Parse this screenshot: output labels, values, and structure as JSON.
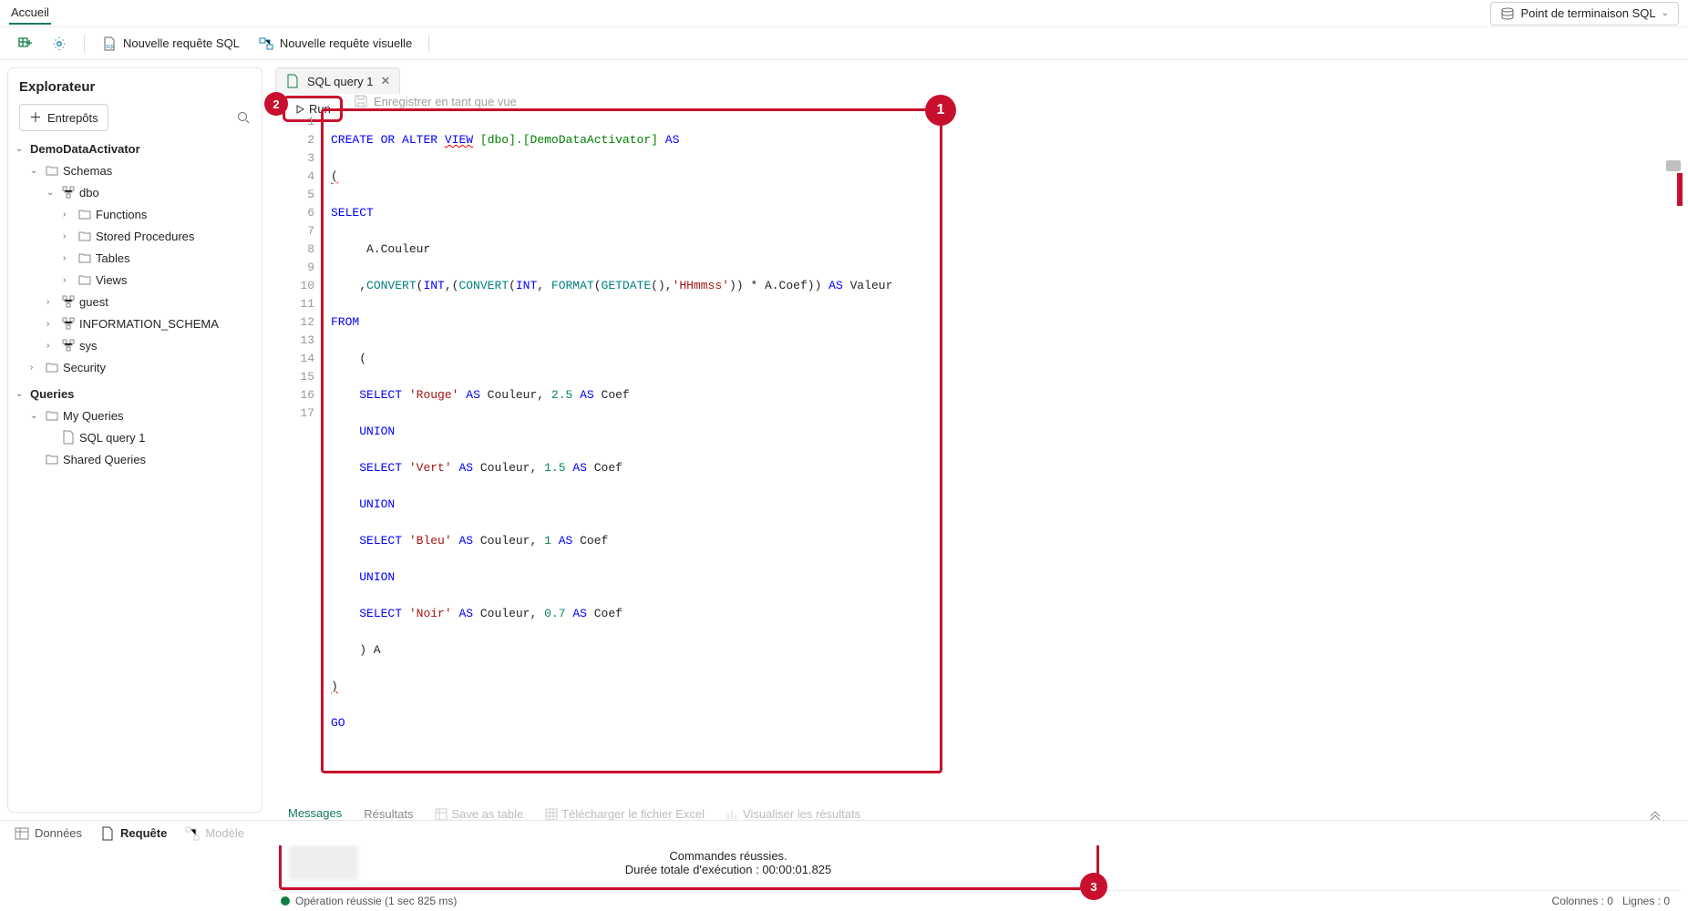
{
  "topbar": {
    "home": "Accueil",
    "endpoint": "Point de terminaison SQL"
  },
  "toolbar": {
    "new_sql": "Nouvelle requête SQL",
    "new_visual": "Nouvelle requête visuelle"
  },
  "explorer": {
    "title": "Explorateur",
    "entrepots": "Entrepôts",
    "tree": {
      "db": "DemoDataActivator",
      "schemas": "Schemas",
      "dbo": "dbo",
      "functions": "Functions",
      "sprocs": "Stored Procedures",
      "tables": "Tables",
      "views": "Views",
      "guest": "guest",
      "infoschema": "INFORMATION_SCHEMA",
      "sys": "sys",
      "security": "Security",
      "queries": "Queries",
      "myqueries": "My Queries",
      "sqlquery1": "SQL query 1",
      "sharedqueries": "Shared Queries"
    }
  },
  "tab": {
    "name": "SQL query 1"
  },
  "runbar": {
    "run": "Run",
    "save_view": "Enregistrer en tant que vue"
  },
  "badges": {
    "b1": "1",
    "b2": "2",
    "b3": "3"
  },
  "code": {
    "l1a": "CREATE",
    "l1b": "OR",
    "l1c": "ALTER",
    "l1d": "VIEW",
    "l1e": "[dbo].[DemoDataActivator]",
    "l1f": "AS",
    "l2": "(",
    "l3": "SELECT",
    "l4": "     A.Couleur",
    "l5a": "    ,",
    "l5b": "CONVERT",
    "l5c": "(",
    "l5d": "INT",
    "l5e": ",(",
    "l5f": "CONVERT",
    "l5g": "(",
    "l5h": "INT",
    "l5i": ",",
    "l5j": " FORMAT",
    "l5k": "(",
    "l5l": "GETDATE",
    "l5m": "(),",
    "l5n": "'HHmmss'",
    "l5o": ")) * A.Coef)) ",
    "l5p": "AS",
    "l5q": " Valeur",
    "l6": "FROM",
    "l7": "    (",
    "l8a": "    ",
    "l8b": "SELECT",
    "l8c": " ",
    "l8d": "'Rouge'",
    "l8e": " ",
    "l8f": "AS",
    "l8g": " Couleur, ",
    "l8h": "2.5",
    "l8i": " ",
    "l8j": "AS",
    "l8k": " Coef",
    "l9": "    ",
    "l9b": "UNION",
    "l10a": "    ",
    "l10b": "SELECT",
    "l10c": " ",
    "l10d": "'Vert'",
    "l10e": " ",
    "l10f": "AS",
    "l10g": " Couleur, ",
    "l10h": "1.5",
    "l10i": " ",
    "l10j": "AS",
    "l10k": " Coef",
    "l11": "    ",
    "l11b": "UNION",
    "l12a": "    ",
    "l12b": "SELECT",
    "l12c": " ",
    "l12d": "'Bleu'",
    "l12e": " ",
    "l12f": "AS",
    "l12g": " Couleur, ",
    "l12h": "1",
    "l12i": " ",
    "l12j": "AS",
    "l12k": " Coef",
    "l13": "    ",
    "l13b": "UNION",
    "l14a": "    ",
    "l14b": "SELECT",
    "l14c": " ",
    "l14d": "'Noir'",
    "l14e": " ",
    "l14f": "AS",
    "l14g": " Couleur, ",
    "l14h": "0.7",
    "l14i": " ",
    "l14j": "AS",
    "l14k": " Coef",
    "l15": "    ) A",
    "l16": ")",
    "l17": "GO"
  },
  "gutter": [
    "1",
    "2",
    "3",
    "4",
    "5",
    "6",
    "7",
    "8",
    "9",
    "10",
    "11",
    "12",
    "13",
    "14",
    "15",
    "16",
    "17"
  ],
  "results": {
    "messages": "Messages",
    "resultats": "Résultats",
    "save_table": "Save as table",
    "download_excel": "Télécharger le fichier Excel",
    "visualize": "Visualiser les résultats",
    "msg_l1": "Commandes réussies.",
    "msg_l2": "Durée totale d'exécution : 00:00:01.825"
  },
  "status": {
    "op": "Opération réussie (1 sec 825 ms)",
    "cols": "Colonnes :  0",
    "rows": "Lignes :  0"
  },
  "footer": {
    "donnees": "Données",
    "requete": "Requête",
    "modele": "Modèle"
  }
}
